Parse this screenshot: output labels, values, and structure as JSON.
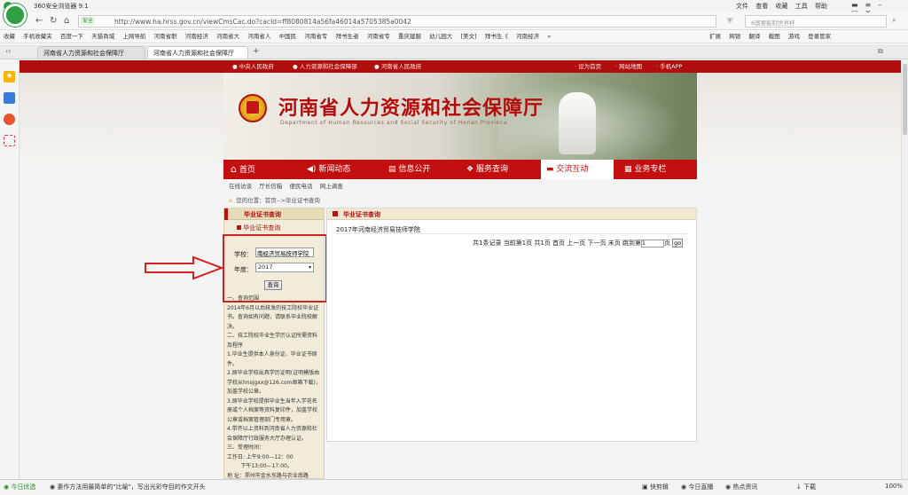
{
  "browser": {
    "title": "360安全浏览器 9.1",
    "menu": [
      "文件",
      "查看",
      "收藏",
      "工具",
      "帮助"
    ],
    "safe_badge": "安全",
    "url": "http://www.ha.hrss.gov.cn/viewCmsCac.do?cacId=ff8080814a56fa46014a5705385a0042",
    "search_placeholder": "6国要能制世界杯",
    "bookmarks": [
      "收藏",
      "手机收藏夹",
      "百度一下",
      "天猫商城",
      "上网导航",
      "河南省职",
      "河南经济",
      "河南省大",
      "河南省人",
      "中国民",
      "河南省专",
      "拜书生者",
      "河南省专",
      "重庆建服",
      "幼儿园大",
      "[美文]",
      "拜书生《",
      "河南经济",
      "»"
    ],
    "bm_right": [
      "扩展",
      "网银",
      "翻译",
      "截图",
      "游戏",
      "登录管家"
    ],
    "tabs": [
      "河南省人力资源和社会保障厅",
      "河南省人力资源和社会保障厅",
      "+"
    ]
  },
  "site": {
    "toplinks_left": [
      "中央人民政府",
      "人力资源和社会保障部",
      "河南省人民政府"
    ],
    "toplinks_right": [
      "设为首页",
      "网站地图",
      "手机APP"
    ],
    "title": "河南省人力资源和社会保障厅",
    "subtitle": "Department of Human Resources and Social Security of Henan Province",
    "nav": [
      {
        "icon": "⌂",
        "label": "首页"
      },
      {
        "icon": "◀)",
        "label": "新闻动态"
      },
      {
        "icon": "▤",
        "label": "信息公开"
      },
      {
        "icon": "❖",
        "label": "服务查询"
      },
      {
        "icon": "▬",
        "label": "交流互动"
      },
      {
        "icon": "▦",
        "label": "业务专栏"
      }
    ],
    "subnav": [
      "在线访谈",
      "厅长信箱",
      "便民电话",
      "网上调查"
    ],
    "breadcrumb": "您的位置：首页-->毕业证书查询"
  },
  "left": {
    "header": "毕业证书查询",
    "subitem": "毕业证书查询",
    "school_label": "学校：",
    "school_value": "南经济贸易技师学院",
    "year_label": "年度：",
    "year_value": "2017",
    "query_button": "查询",
    "notes": [
      "一、查询范围",
      "2014年6月以后核发的技工院校毕业证书。查询如有问题，请联系毕业院校解决。",
      "二、技工院校毕业生学历认证所需资料及程序",
      "1.毕业生提供本人身份证、毕业证书原件。",
      "2.原毕业学校出具学历证明(证明模版由学校从hnsjgxx@126.com邮箱下载)，加盖学校公章。",
      "3.原毕业学校提供毕业生当年入学花名册或个人档案等资料复印件，加盖学校公章或档案管理部门专用章。",
      "4.带齐以上资料到河南省人力资源和社会保障厅行政服务大厅办理认证。",
      "三、受理时间：",
      "工作日: 上午9:00—12：00",
      "        下午13:00—17:00。",
      "地 址：郑州市金水东路与农业南路"
    ]
  },
  "results": {
    "header": "毕业证书查询",
    "row": "2017年河南经济贸易技师学院",
    "pager_text": "共1条记录 当前第1页 共1页 首页 上一页 下一页 末页 跳到第",
    "page_value": "1",
    "page_suffix": "页",
    "go": "go"
  },
  "status": {
    "left": [
      "今日优选",
      "妻作方法用最简单的\"比喻\"，写出光彩夺目的作文开头"
    ],
    "right": [
      "快剪辑",
      "今日直播",
      "热点资讯",
      "下载",
      "100%"
    ]
  },
  "colors": {
    "brand_red": "#c30f0f",
    "top_red": "#b00d0d",
    "annotation_red": "#d32020"
  }
}
